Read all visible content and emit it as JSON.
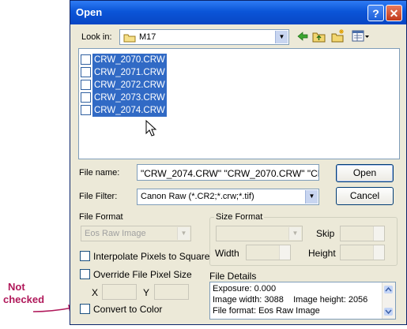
{
  "dialog": {
    "title": "Open",
    "help_button": "?",
    "close_button": "✕"
  },
  "look_in": {
    "label": "Look in:",
    "value": "M17"
  },
  "files": [
    {
      "name": "CRW_2070.CRW",
      "selected": true
    },
    {
      "name": "CRW_2071.CRW",
      "selected": true
    },
    {
      "name": "CRW_2072.CRW",
      "selected": true
    },
    {
      "name": "CRW_2073.CRW",
      "selected": true
    },
    {
      "name": "CRW_2074.CRW",
      "selected": true
    }
  ],
  "file_name": {
    "label": "File name:",
    "value": "\"CRW_2074.CRW\" \"CRW_2070.CRW\" \"CRW"
  },
  "file_filter": {
    "label": "File Filter:",
    "value": "Canon Raw (*.CR2;*.crw;*.tif)"
  },
  "buttons": {
    "open": "Open",
    "cancel": "Cancel"
  },
  "file_format": {
    "label": "File Format",
    "value": "Eos Raw Image"
  },
  "interpolate": {
    "label": "Interpolate Pixels to Square",
    "checked": false
  },
  "override": {
    "label": "Override File Pixel Size",
    "checked": false,
    "x_label": "X",
    "y_label": "Y"
  },
  "convert_color": {
    "label": "Convert to Color",
    "checked": false
  },
  "size_format": {
    "label": "Size Format",
    "skip_label": "Skip",
    "width_label": "Width",
    "height_label": "Height"
  },
  "file_details": {
    "label": "File Details",
    "lines": [
      "Exposure: 0.000",
      "Image width: 3088    Image height: 2056",
      "File format: Eos Raw Image"
    ]
  },
  "annotation": {
    "line1": "Not",
    "line2": "checked",
    "color": "#b0185a"
  }
}
